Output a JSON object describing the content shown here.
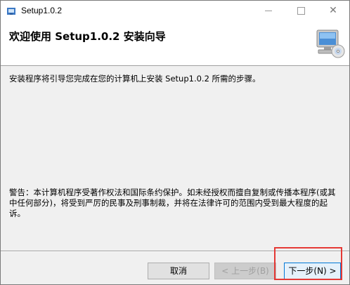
{
  "window": {
    "title": "Setup1.0.2",
    "close_glyph": "✕"
  },
  "banner": {
    "title": "欢迎使用 Setup1.0.2 安装向导",
    "icon": "computer-cd-icon"
  },
  "body": {
    "intro": "安装程序将引导您完成在您的计算机上安装 Setup1.0.2 所需的步骤。",
    "copyright": "警告：本计算机程序受著作权法和国际条约保护。如未经授权而擅自复制或传播本程序(或其中任何部分)，将受到严厉的民事及刑事制裁，并将在法律许可的范围内受到最大程度的起诉。"
  },
  "buttons": {
    "cancel": "取消",
    "back": "< 上一步(B)",
    "next": "下一步(N) >"
  },
  "colors": {
    "highlight": "#e53935",
    "next_border": "#0078d7"
  }
}
